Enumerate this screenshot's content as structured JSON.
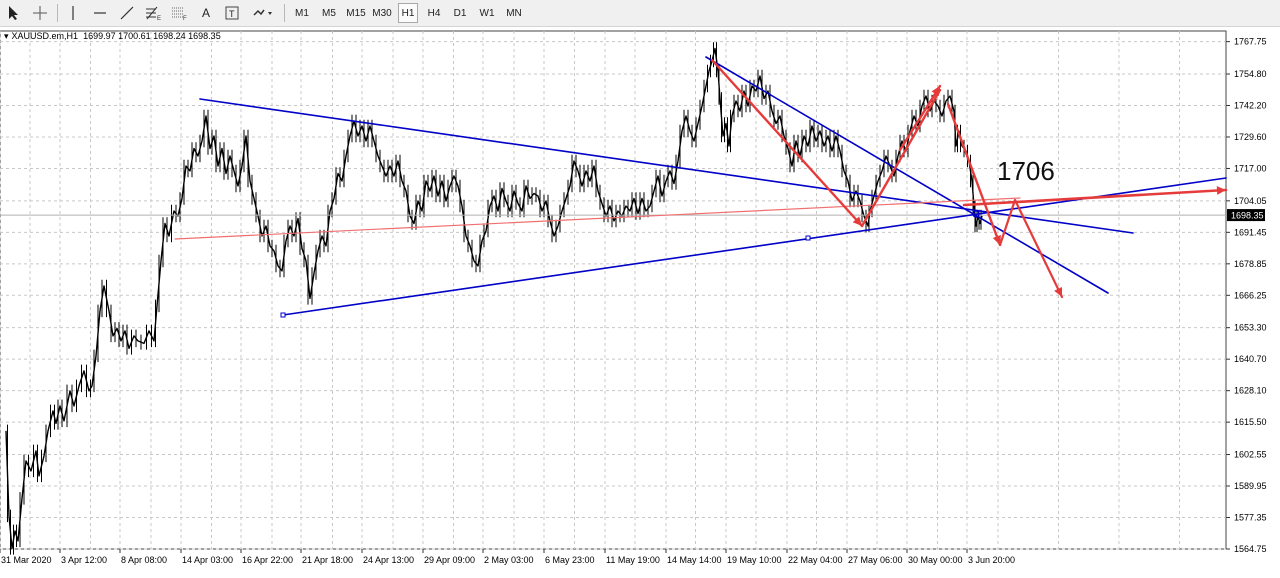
{
  "toolbar": {
    "tools": [
      "cursor-tool",
      "crosshair-tool",
      "vertical-line-tool",
      "horizontal-line-tool",
      "trendline-tool",
      "fibonacci-tool",
      "grid-tool",
      "text-tool",
      "text-label-tool",
      "shapes-tool"
    ],
    "text_tool_label": "A",
    "timeframes": [
      "M1",
      "M5",
      "M15",
      "M30",
      "H1",
      "H4",
      "D1",
      "W1",
      "MN"
    ],
    "active_timeframe": "H1"
  },
  "symbol_info": {
    "name": "XAUUSD.em,H1",
    "ohlc": "1699.97 1700.61 1698.24 1698.35"
  },
  "chart_data": {
    "type": "line",
    "symbol": "XAUUSD.em",
    "timeframe": "H1",
    "x_labels": [
      "31 Mar 2020",
      "3 Apr 12:00",
      "8 Apr 08:00",
      "14 Apr 03:00",
      "16 Apr 22:00",
      "21 Apr 18:00",
      "24 Apr 13:00",
      "29 Apr 09:00",
      "2 May 03:00",
      "6 May 23:00",
      "11 May 19:00",
      "14 May 14:00",
      "19 May 10:00",
      "22 May 04:00",
      "27 May 06:00",
      "30 May 00:00",
      "3 Jun 20:00"
    ],
    "y_ticks": [
      1767.75,
      1754.8,
      1742.2,
      1729.6,
      1717.0,
      1704.05,
      1691.45,
      1678.85,
      1666.25,
      1653.3,
      1640.7,
      1628.1,
      1615.5,
      1602.55,
      1589.95,
      1577.35,
      1564.75
    ],
    "ylim": [
      1564.75,
      1772
    ],
    "current_price": "1698.35",
    "close_series": [
      [
        0,
        1612
      ],
      [
        3,
        1578
      ],
      [
        6,
        1565
      ],
      [
        9,
        1572
      ],
      [
        12,
        1568
      ],
      [
        16,
        1585
      ],
      [
        20,
        1600
      ],
      [
        25,
        1596
      ],
      [
        30,
        1604
      ],
      [
        33,
        1594
      ],
      [
        38,
        1602
      ],
      [
        42,
        1612
      ],
      [
        47,
        1620
      ],
      [
        50,
        1615
      ],
      [
        54,
        1622
      ],
      [
        58,
        1616
      ],
      [
        64,
        1628
      ],
      [
        68,
        1622
      ],
      [
        73,
        1630
      ],
      [
        78,
        1636
      ],
      [
        83,
        1628
      ],
      [
        86,
        1630
      ],
      [
        90,
        1642
      ],
      [
        94,
        1660
      ],
      [
        98,
        1670
      ],
      [
        103,
        1660
      ],
      [
        107,
        1650
      ],
      [
        111,
        1653
      ],
      [
        115,
        1648
      ],
      [
        119,
        1652
      ],
      [
        123,
        1645
      ],
      [
        128,
        1650
      ],
      [
        132,
        1648
      ],
      [
        138,
        1647
      ],
      [
        143,
        1652
      ],
      [
        148,
        1648
      ],
      [
        151,
        1662
      ],
      [
        155,
        1680
      ],
      [
        159,
        1695
      ],
      [
        163,
        1690
      ],
      [
        168,
        1700
      ],
      [
        172,
        1698
      ],
      [
        176,
        1705
      ],
      [
        180,
        1718
      ],
      [
        184,
        1716
      ],
      [
        188,
        1725
      ],
      [
        192,
        1722
      ],
      [
        196,
        1728
      ],
      [
        200,
        1738
      ],
      [
        204,
        1725
      ],
      [
        208,
        1730
      ],
      [
        212,
        1718
      ],
      [
        216,
        1725
      ],
      [
        220,
        1715
      ],
      [
        224,
        1722
      ],
      [
        228,
        1716
      ],
      [
        232,
        1710
      ],
      [
        236,
        1718
      ],
      [
        240,
        1730
      ],
      [
        244,
        1712
      ],
      [
        248,
        1705
      ],
      [
        252,
        1698
      ],
      [
        256,
        1690
      ],
      [
        260,
        1694
      ],
      [
        264,
        1686
      ],
      [
        268,
        1684
      ],
      [
        272,
        1678
      ],
      [
        276,
        1676
      ],
      [
        280,
        1688
      ],
      [
        284,
        1694
      ],
      [
        288,
        1690
      ],
      [
        292,
        1697
      ],
      [
        296,
        1685
      ],
      [
        300,
        1680
      ],
      [
        304,
        1665
      ],
      [
        308,
        1675
      ],
      [
        312,
        1684
      ],
      [
        316,
        1690
      ],
      [
        320,
        1686
      ],
      [
        324,
        1700
      ],
      [
        328,
        1705
      ],
      [
        332,
        1715
      ],
      [
        336,
        1712
      ],
      [
        340,
        1722
      ],
      [
        344,
        1730
      ],
      [
        348,
        1736
      ],
      [
        352,
        1730
      ],
      [
        356,
        1734
      ],
      [
        360,
        1728
      ],
      [
        364,
        1734
      ],
      [
        368,
        1728
      ],
      [
        372,
        1722
      ],
      [
        376,
        1718
      ],
      [
        380,
        1714
      ],
      [
        384,
        1718
      ],
      [
        388,
        1714
      ],
      [
        392,
        1720
      ],
      [
        396,
        1712
      ],
      [
        400,
        1708
      ],
      [
        404,
        1698
      ],
      [
        408,
        1695
      ],
      [
        412,
        1704
      ],
      [
        416,
        1700
      ],
      [
        420,
        1712
      ],
      [
        424,
        1708
      ],
      [
        428,
        1714
      ],
      [
        432,
        1706
      ],
      [
        436,
        1712
      ],
      [
        440,
        1704
      ],
      [
        444,
        1710
      ],
      [
        448,
        1714
      ],
      [
        452,
        1710
      ],
      [
        456,
        1702
      ],
      [
        460,
        1690
      ],
      [
        464,
        1686
      ],
      [
        468,
        1680
      ],
      [
        472,
        1678
      ],
      [
        476,
        1688
      ],
      [
        480,
        1692
      ],
      [
        484,
        1702
      ],
      [
        488,
        1706
      ],
      [
        492,
        1700
      ],
      [
        496,
        1709
      ],
      [
        500,
        1704
      ],
      [
        504,
        1700
      ],
      [
        508,
        1708
      ],
      [
        512,
        1703
      ],
      [
        516,
        1700
      ],
      [
        520,
        1710
      ],
      [
        524,
        1705
      ],
      [
        528,
        1707
      ],
      [
        532,
        1706
      ],
      [
        536,
        1700
      ],
      [
        540,
        1704
      ],
      [
        544,
        1696
      ],
      [
        548,
        1690
      ],
      [
        552,
        1694
      ],
      [
        556,
        1700
      ],
      [
        560,
        1705
      ],
      [
        564,
        1710
      ],
      [
        568,
        1720
      ],
      [
        572,
        1716
      ],
      [
        576,
        1710
      ],
      [
        580,
        1716
      ],
      [
        584,
        1712
      ],
      [
        588,
        1718
      ],
      [
        592,
        1708
      ],
      [
        596,
        1703
      ],
      [
        600,
        1698
      ],
      [
        604,
        1702
      ],
      [
        608,
        1696
      ],
      [
        612,
        1700
      ],
      [
        616,
        1698
      ],
      [
        620,
        1702
      ],
      [
        624,
        1700
      ],
      [
        628,
        1705
      ],
      [
        632,
        1699
      ],
      [
        636,
        1705
      ],
      [
        640,
        1700
      ],
      [
        644,
        1702
      ],
      [
        648,
        1708
      ],
      [
        652,
        1714
      ],
      [
        656,
        1706
      ],
      [
        660,
        1712
      ],
      [
        664,
        1716
      ],
      [
        668,
        1711
      ],
      [
        672,
        1720
      ],
      [
        676,
        1732
      ],
      [
        680,
        1738
      ],
      [
        684,
        1732
      ],
      [
        688,
        1728
      ],
      [
        692,
        1735
      ],
      [
        696,
        1742
      ],
      [
        700,
        1750
      ],
      [
        703,
        1756
      ],
      [
        706,
        1760
      ],
      [
        709,
        1765
      ],
      [
        712,
        1756
      ],
      [
        714,
        1745
      ],
      [
        717,
        1730
      ],
      [
        720,
        1735
      ],
      [
        723,
        1726
      ],
      [
        726,
        1738
      ],
      [
        730,
        1744
      ],
      [
        734,
        1740
      ],
      [
        738,
        1748
      ],
      [
        742,
        1742
      ],
      [
        746,
        1750
      ],
      [
        750,
        1748
      ],
      [
        754,
        1754
      ],
      [
        758,
        1745
      ],
      [
        762,
        1748
      ],
      [
        766,
        1740
      ],
      [
        770,
        1735
      ],
      [
        774,
        1738
      ],
      [
        778,
        1730
      ],
      [
        782,
        1725
      ],
      [
        786,
        1718
      ],
      [
        790,
        1728
      ],
      [
        794,
        1722
      ],
      [
        798,
        1730
      ],
      [
        802,
        1726
      ],
      [
        806,
        1734
      ],
      [
        810,
        1728
      ],
      [
        814,
        1732
      ],
      [
        818,
        1726
      ],
      [
        822,
        1730
      ],
      [
        826,
        1724
      ],
      [
        830,
        1730
      ],
      [
        834,
        1724
      ],
      [
        838,
        1716
      ],
      [
        842,
        1712
      ],
      [
        846,
        1704
      ],
      [
        850,
        1708
      ],
      [
        854,
        1704
      ],
      [
        858,
        1698
      ],
      [
        862,
        1694
      ],
      [
        864,
        1700
      ],
      [
        868,
        1706
      ],
      [
        872,
        1712
      ],
      [
        876,
        1716
      ],
      [
        880,
        1722
      ],
      [
        884,
        1718
      ],
      [
        888,
        1714
      ],
      [
        892,
        1722
      ],
      [
        896,
        1728
      ],
      [
        900,
        1724
      ],
      [
        904,
        1732
      ],
      [
        908,
        1738
      ],
      [
        912,
        1734
      ],
      [
        916,
        1742
      ],
      [
        920,
        1746
      ],
      [
        924,
        1740
      ],
      [
        928,
        1744
      ],
      [
        932,
        1742
      ],
      [
        936,
        1738
      ],
      [
        940,
        1744
      ],
      [
        944,
        1746
      ],
      [
        948,
        1740
      ],
      [
        950,
        1726
      ],
      [
        953,
        1732
      ],
      [
        956,
        1726
      ],
      [
        960,
        1724
      ],
      [
        963,
        1720
      ],
      [
        966,
        1712
      ],
      [
        968,
        1702
      ],
      [
        970,
        1694
      ],
      [
        972,
        1698
      ],
      [
        974,
        1695
      ],
      [
        976,
        1698
      ]
    ]
  },
  "annotations": {
    "price_note": "1706"
  },
  "colors": {
    "candles": "#000000",
    "trendlines": "#0000c8",
    "arrows": "#e63b3b",
    "grid": "#c8c8c8",
    "price_label_bg": "#000000",
    "price_label_text": "#ffffff"
  }
}
